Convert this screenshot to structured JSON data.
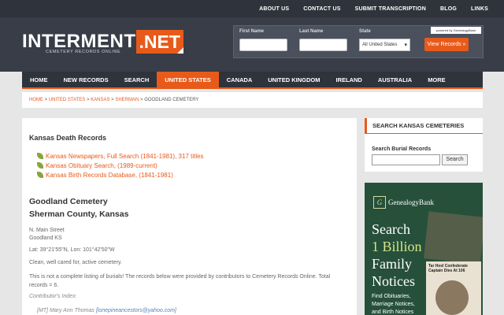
{
  "topnav": [
    "ABOUT US",
    "CONTACT US",
    "SUBMIT TRANSCRIPTION",
    "BLOG",
    "LINKS"
  ],
  "logo": {
    "main": "INTERMENT",
    "dot": ".NET",
    "tagline": "CEMETERY RECORDS ONLINE"
  },
  "search": {
    "first_label": "First Name",
    "last_label": "Last Name",
    "state_label": "State",
    "state_value": "All United States",
    "button": "View Records »",
    "powered": "powered by GenealogyBank"
  },
  "nav": [
    {
      "label": "HOME",
      "active": false
    },
    {
      "label": "NEW RECORDS",
      "active": false
    },
    {
      "label": "SEARCH",
      "active": false
    },
    {
      "label": "UNITED STATES",
      "active": true
    },
    {
      "label": "CANADA",
      "active": false
    },
    {
      "label": "UNITED KINGDOM",
      "active": false
    },
    {
      "label": "IRELAND",
      "active": false
    },
    {
      "label": "AUSTRALIA",
      "active": false
    },
    {
      "label": "MORE",
      "active": false
    }
  ],
  "breadcrumb": {
    "home": "HOME",
    "sep": " > ",
    "us": "UNITED STATES",
    "state": "KANSAS",
    "county": "SHERMAN",
    "current": "GOODLAND CEMETERY"
  },
  "main": {
    "heading": "Kansas Death Records",
    "records": [
      "Kansas Newspapers, Full Search (1841-1981), 317 titles",
      "Kansas Obituary Search, (1989-current)",
      "Kansas Birth Records Database, (1841-1981)"
    ],
    "cemetery": "Goodland Cemetery",
    "county": "Sherman County, Kansas",
    "address1": "N. Main Street",
    "address2": "Goodland KS",
    "latlon": "Lat: 39°21'55\"N, Lon: 101°42'50\"W",
    "description": "Clean, well cared for, active cemetery.",
    "note": "This is not a complete listing of burials! The records below were provided by contributors to Cemetery Records Online. Total records = 6.",
    "index_label": "Contributor's Index:",
    "contributor": "[MT] Mary Ann Thomas",
    "contributor_email": "[lonepineancestors@yahoo.com]"
  },
  "sidebar": {
    "title": "SEARCH KANSAS CEMETERIES",
    "label": "Search Burial Records",
    "button": "Search"
  },
  "ad": {
    "brand": "GenealogyBank",
    "line1": "Search",
    "line2": "1 Billion",
    "line3": "Family",
    "line4": "Notices",
    "small": "Find Obituaries, Marriage Notices, and Birth Notices",
    "news": "Tar Heel Confederate Captain Dies At 106"
  }
}
